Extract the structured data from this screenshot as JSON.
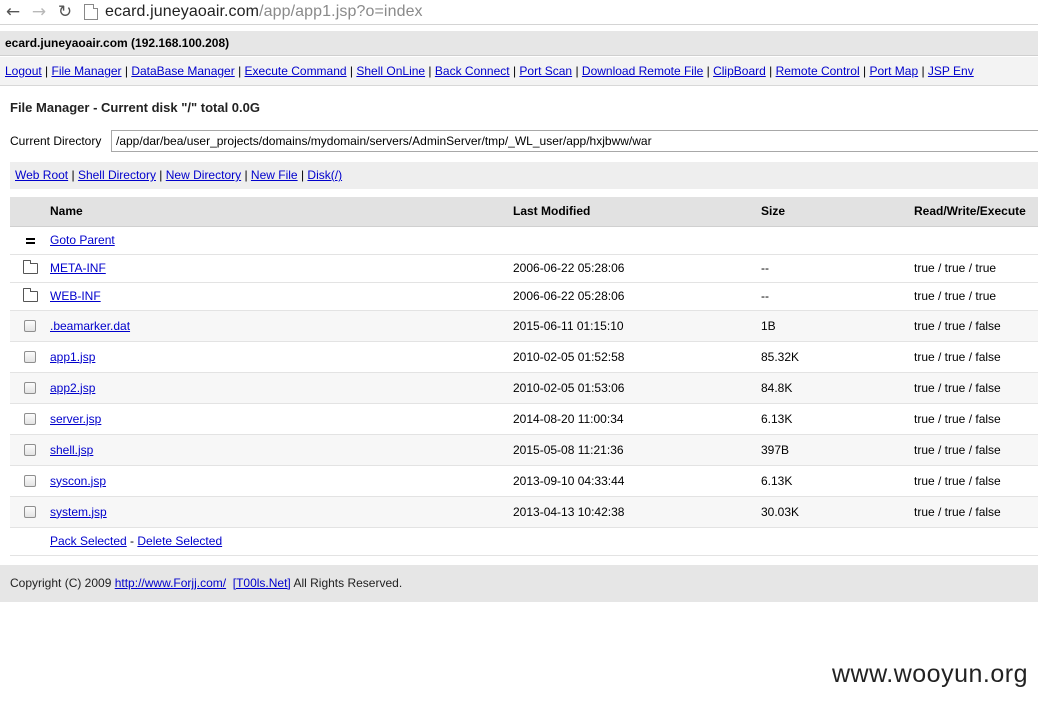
{
  "browser": {
    "back_icon": "back-arrow-icon",
    "forward_icon": "forward-arrow-icon",
    "reload_icon": "reload-icon",
    "url_host": "ecard.juneyaoair.com",
    "url_path": "/app/app1.jsp?o=index"
  },
  "host_header": "ecard.juneyaoair.com (192.168.100.208)",
  "menu": [
    "Logout",
    "File Manager",
    "DataBase Manager",
    "Execute Command",
    "Shell OnLine",
    "Back Connect",
    "Port Scan",
    "Download Remote File",
    "ClipBoard",
    "Remote Control",
    "Port Map",
    "JSP Env"
  ],
  "file_manager": {
    "title": "File Manager - Current disk \"/\" total 0.0G",
    "current_dir_label": "Current Directory",
    "current_dir_value": "/app/dar/bea/user_projects/domains/mydomain/servers/AdminServer/tmp/_WL_user/app/hxjbww/war",
    "quick_links": [
      "Web Root",
      "Shell Directory",
      "New Directory",
      "New File",
      "Disk(/)"
    ],
    "columns": [
      "Name",
      "Last Modified",
      "Size",
      "Read/Write/Execute"
    ],
    "goto_parent": "Goto Parent",
    "entries": [
      {
        "name": "META-INF",
        "modified": "2006-06-22 05:28:06",
        "size": "--",
        "rwx": "true / true / true",
        "kind": "folder"
      },
      {
        "name": "WEB-INF",
        "modified": "2006-06-22 05:28:06",
        "size": "--",
        "rwx": "true / true / true",
        "kind": "folder"
      },
      {
        "name": ".beamarker.dat",
        "modified": "2015-06-11 01:15:10",
        "size": "1B",
        "rwx": "true / true / false",
        "kind": "file"
      },
      {
        "name": "app1.jsp",
        "modified": "2010-02-05 01:52:58",
        "size": "85.32K",
        "rwx": "true / true / false",
        "kind": "file"
      },
      {
        "name": "app2.jsp",
        "modified": "2010-02-05 01:53:06",
        "size": "84.8K",
        "rwx": "true / true / false",
        "kind": "file"
      },
      {
        "name": "server.jsp",
        "modified": "2014-08-20 11:00:34",
        "size": "6.13K",
        "rwx": "true / true / false",
        "kind": "file"
      },
      {
        "name": "shell.jsp",
        "modified": "2015-05-08 11:21:36",
        "size": "397B",
        "rwx": "true / true / false",
        "kind": "file"
      },
      {
        "name": "syscon.jsp",
        "modified": "2013-09-10 04:33:44",
        "size": "6.13K",
        "rwx": "true / true / false",
        "kind": "file"
      },
      {
        "name": "system.jsp",
        "modified": "2013-04-13 10:42:38",
        "size": "30.03K",
        "rwx": "true / true / false",
        "kind": "file"
      }
    ],
    "pack_selected": "Pack Selected",
    "bulk_separator": " - ",
    "delete_selected": "Delete Selected"
  },
  "footer": {
    "copyright": "Copyright (C) 2009 ",
    "link1": "http://www.Forjj.com/",
    "link2": "[T00ls.Net]",
    "rights": " All Rights Reserved."
  },
  "watermark": "www.wooyun.org"
}
